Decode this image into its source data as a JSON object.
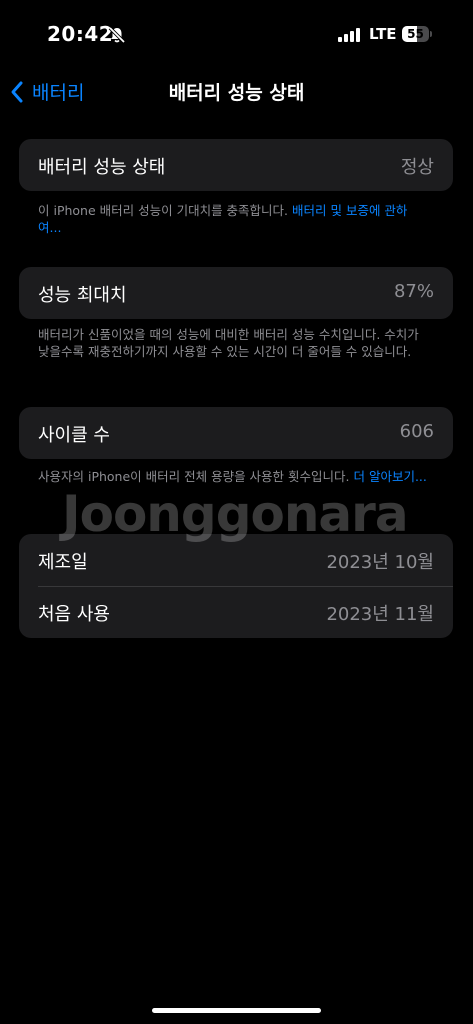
{
  "status_bar": {
    "time": "20:42",
    "network": "LTE",
    "battery_level": "55",
    "battery_fraction": 0.55
  },
  "nav": {
    "back_label": "배터리",
    "title": "배터리 성능 상태"
  },
  "health_card": {
    "label": "배터리 성능 상태",
    "value": "정상"
  },
  "health_footnote": {
    "text": "이 iPhone 배터리 성능이 기대치를 충족합니다. ",
    "link": "배터리 및 보증에 관하여..."
  },
  "capacity_card": {
    "label": "성능 최대치",
    "value": "87%"
  },
  "capacity_footnote": {
    "text": "배터리가 신품이었을 때의 성능에 대비한 배터리 성능 수치입니다. 수치가 낮을수록 재충전하기까지 사용할 수 있는 시간이 더 줄어들 수 있습니다."
  },
  "cycle_card": {
    "label": "사이클 수",
    "value": "606"
  },
  "cycle_footnote": {
    "text": "사용자의 iPhone이 배터리 전체 용량을 사용한 횟수입니다. ",
    "link": "더 알아보기..."
  },
  "dates_card": {
    "manufacture_label": "제조일",
    "manufacture_value": "2023년 10월",
    "first_use_label": "처음 사용",
    "first_use_value": "2023년 11월"
  },
  "watermark": "Joonggonara"
}
